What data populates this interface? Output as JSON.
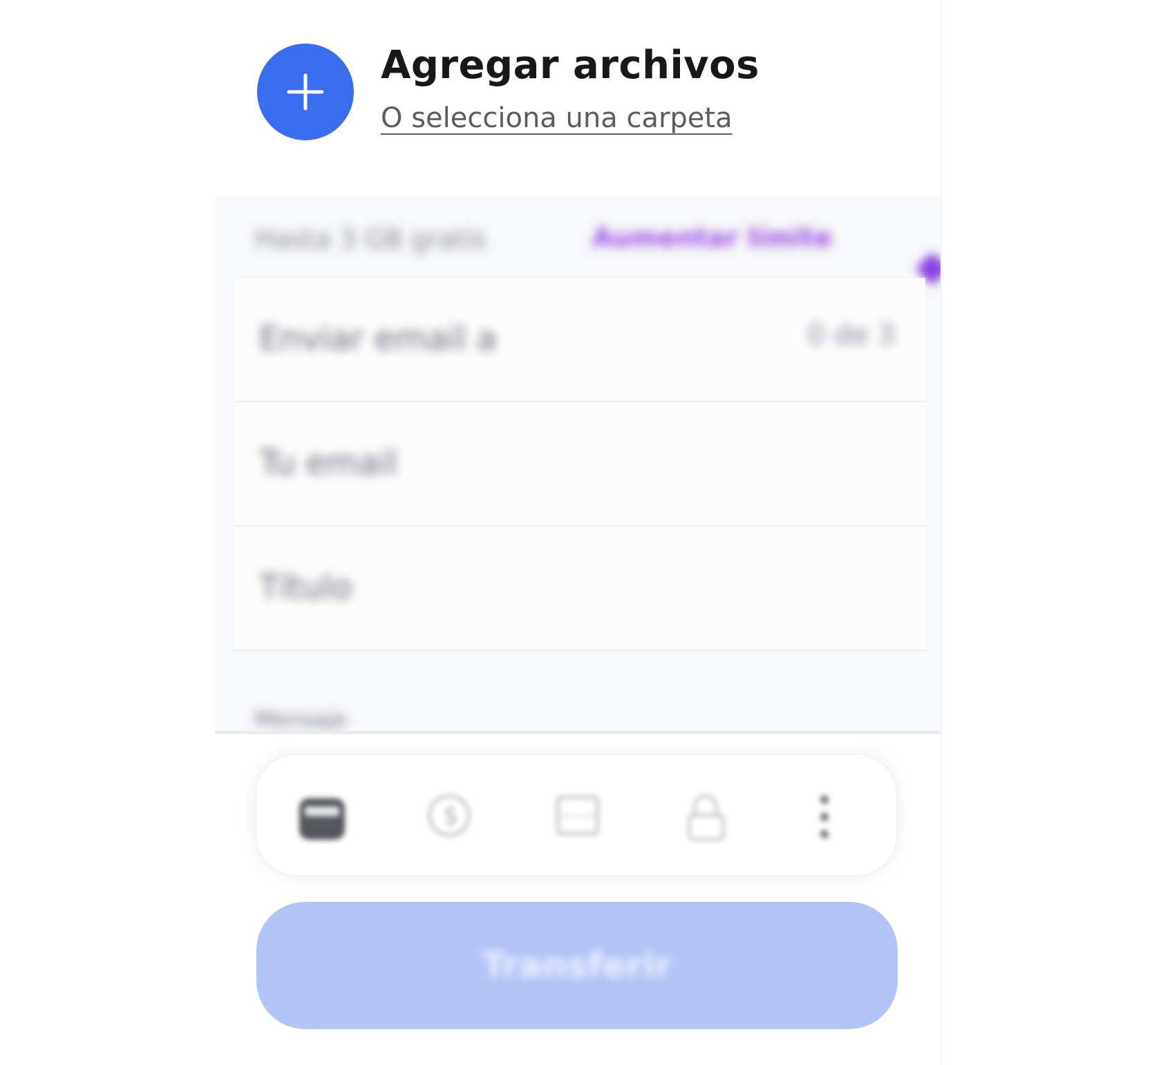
{
  "header": {
    "add_title": "Agregar archivos",
    "folder_link": "O selecciona una carpeta"
  },
  "form": {
    "limit_text": "Hasta 3 GB gratis",
    "upgrade_label": "Aumentar límite",
    "fields": [
      {
        "placeholder": "Enviar email a",
        "counter": "0 de 3"
      },
      {
        "placeholder": "Tu email"
      },
      {
        "placeholder": "Título"
      }
    ],
    "advanced_label": "Mensaje"
  },
  "options": {
    "icons": [
      "calendar-icon",
      "currency-icon",
      "image-icon",
      "lock-icon",
      "more-vertical-icon"
    ]
  },
  "transfer": {
    "label": "Transferir"
  },
  "colors": {
    "primary": "#3a6cf0",
    "primary_disabled": "#b2c4f6",
    "upgrade": "#9b4fe0"
  }
}
